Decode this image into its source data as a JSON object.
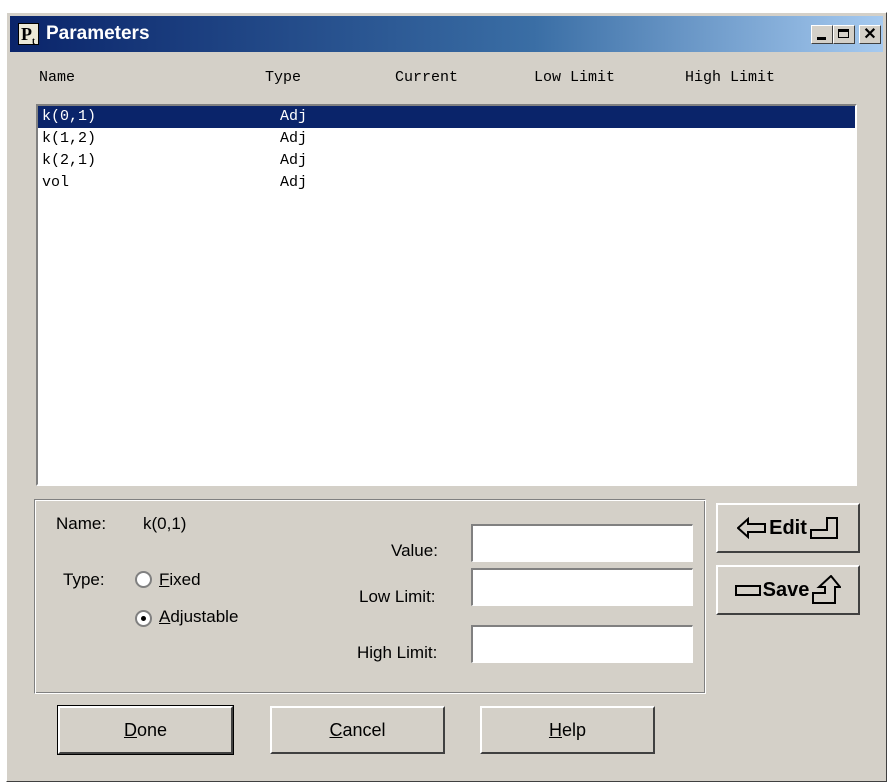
{
  "window": {
    "title": "Parameters",
    "icon_letter": "P",
    "icon_sub": "t",
    "close_glyph": "✕"
  },
  "columns": [
    "Name",
    "Type",
    "Current",
    "Low Limit",
    "High Limit"
  ],
  "params": [
    {
      "name": "k(0,1)",
      "type": "Adj",
      "selected": true
    },
    {
      "name": "k(1,2)",
      "type": "Adj"
    },
    {
      "name": "k(2,1)",
      "type": "Adj"
    },
    {
      "name": "vol",
      "type": "Adj"
    }
  ],
  "detail": {
    "name_label": "Name:",
    "name_value": "k(0,1)",
    "type_label": "Type:",
    "type_fixed": "Fixed",
    "type_adjustable": "Adjustable",
    "selected_type": "Adjustable",
    "value_label": "Value:",
    "low_label": "Low Limit:",
    "high_label": "High Limit:",
    "value": "",
    "low": "",
    "high": ""
  },
  "side_buttons": {
    "edit": "Edit",
    "save": "Save"
  },
  "buttons": {
    "done": "Done",
    "cancel": "Cancel",
    "help": "Help"
  },
  "colors": {
    "selection": "#0a246a",
    "face": "#d4d0c8",
    "title_start": "#0a246a",
    "title_end": "#a6caf0"
  },
  "icons": [
    "app-icon",
    "minimize-icon",
    "maximize-icon",
    "close-icon",
    "arrow-left-icon",
    "arrow-return-icon",
    "bar-icon",
    "arrow-up-icon"
  ]
}
